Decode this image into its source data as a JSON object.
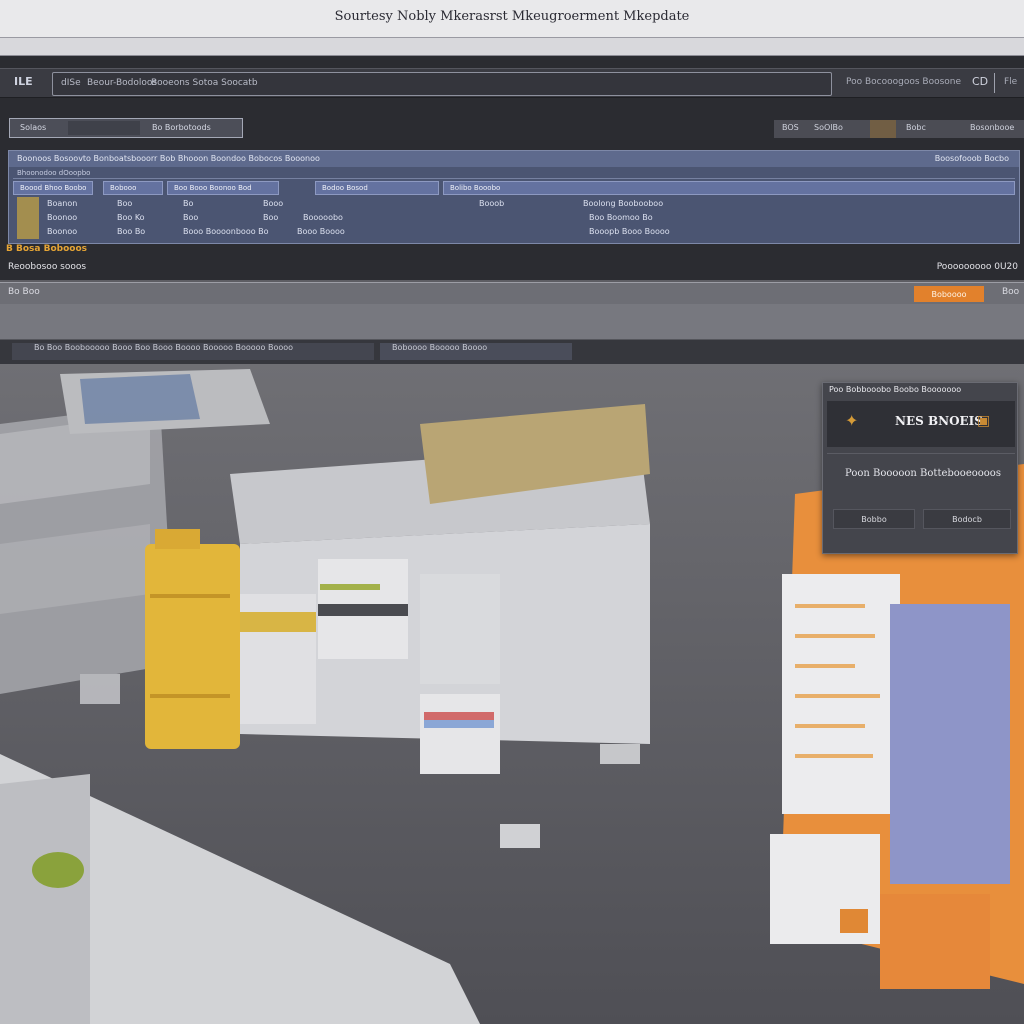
{
  "window": {
    "title": "Sourtesy Nobly Mkerasrst Mkeugroerment Mkepdate"
  },
  "address_bar": {
    "logo": "ILE",
    "url_segments": [
      "dISe",
      "Beour-Bodoloos",
      "Booeons Sotoa Soocatb"
    ],
    "right_text": "Poo Bocooogoos Boosone",
    "right_icon": "CD",
    "extension_text": "Fle"
  },
  "filter": {
    "label": "Solaos",
    "value": "Bo Borbotoods"
  },
  "right_tabs": [
    "BOS",
    "SoOlBo",
    "Bobc",
    "Bosonbooe"
  ],
  "table": {
    "header_title": "Boonoos Bosoovto Bonboatsbooorr Bob Bhooon Boondoo Bobocos Booonoo",
    "header_right": "Boosofooob Bocbo",
    "sub_header": "Bhoonodoo dOoopbo",
    "columns": [
      "Boood Bhoo Boobo",
      "Bobooo",
      "Boo Booo Boonoo Bod",
      "Bodoo Bosod",
      "Bolibo Booobo"
    ],
    "rows": [
      [
        "Boanon",
        "Boo",
        "Bo",
        "Booo",
        "Booob",
        "Boolong Boobooboo"
      ],
      [
        "Boonoo",
        "Boo Ko",
        "Boo",
        "Boo",
        "Booooobo",
        "Boo Boomoo Bo"
      ],
      [
        "Boonoo",
        "Boo Bo",
        "Booo Boooonbooo Bo",
        "Booo Boooo",
        "Booopb Booo Boooo",
        ""
      ]
    ]
  },
  "badge": "B Bosa Bobooos",
  "status": {
    "left": "Reoobosoo sooos",
    "right": "Pooooooooo 0U20"
  },
  "toolbar2": {
    "label": "Bo   Boo",
    "orange_button": "Boboooo",
    "end_text": "Boo"
  },
  "strip4": {
    "field_a_text": "Bo Boo Boobooooo Booo Boo Booo Boooo Booooo Booooo Boooo",
    "field_b_text": "Boboooo Booooo Boooo"
  },
  "dialog": {
    "title": "Poo Bobbooobo Boobo Booooooo",
    "banner_text": "NES BNOEIS",
    "message": "Poon Booooon Bottebooeoooos",
    "button_left": "Bobbo",
    "button_right": "Bodocb"
  },
  "colors": {
    "accent_orange": "#e2812c",
    "table_blue": "#4b5572",
    "bin_yellow": "#e6b93a",
    "box_orange": "#e88f3c",
    "folder_blue": "#8e95c8",
    "lime_cap": "#8aa23c"
  },
  "icons": [
    "logo-icon",
    "cd-icon",
    "banner-logo-icon",
    "banner-badge-icon"
  ]
}
